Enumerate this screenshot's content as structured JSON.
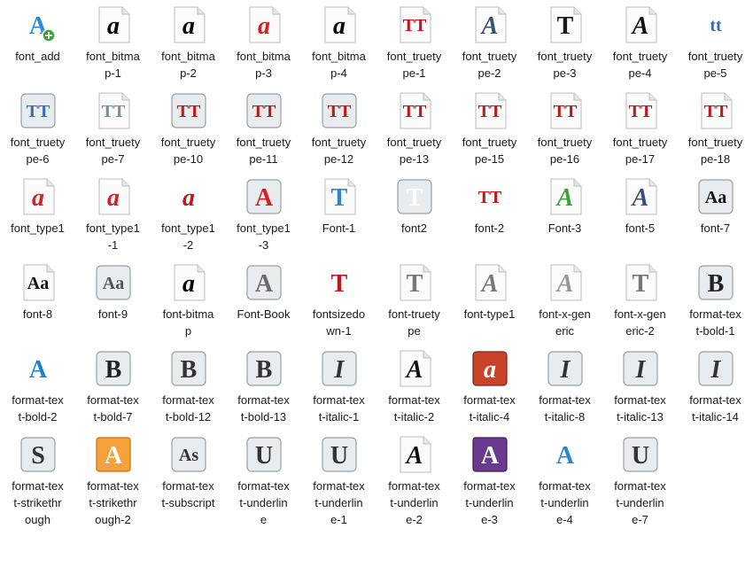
{
  "icons": [
    {
      "label": "font_add",
      "glyph": "A",
      "style": "plain",
      "color": "#2a8bd6",
      "badge": "plus"
    },
    {
      "label": "font_bitma\np-1",
      "glyph": "a",
      "style": "page",
      "color": "#000000"
    },
    {
      "label": "font_bitma\np-2",
      "glyph": "a",
      "style": "page",
      "color": "#000000"
    },
    {
      "label": "font_bitma\np-3",
      "glyph": "a",
      "style": "page",
      "color": "#d62020"
    },
    {
      "label": "font_bitma\np-4",
      "glyph": "a",
      "style": "page",
      "color": "#000000"
    },
    {
      "label": "font_truety\npe-1",
      "glyph": "TT",
      "style": "page",
      "color": "#c01818"
    },
    {
      "label": "font_truety\npe-2",
      "glyph": "A",
      "style": "page",
      "color": "#3a4f78"
    },
    {
      "label": "font_truety\npe-3",
      "glyph": "T",
      "style": "page",
      "color": "#1a1a1a"
    },
    {
      "label": "font_truety\npe-4",
      "glyph": "A",
      "style": "page",
      "color": "#111111"
    },
    {
      "label": "font_truety\npe-5",
      "glyph": "tt",
      "style": "plain",
      "color": "#2f6ab8"
    },
    {
      "label": "font_truety\npe-6",
      "glyph": "TT",
      "style": "box",
      "color": "#3a6fb0"
    },
    {
      "label": "font_truety\npe-7",
      "glyph": "TT",
      "style": "page",
      "color": "#7f8c9a"
    },
    {
      "label": "font_truety\npe-10",
      "glyph": "TT",
      "style": "box",
      "color": "#c01818"
    },
    {
      "label": "font_truety\npe-11",
      "glyph": "TT",
      "style": "box",
      "color": "#c01818"
    },
    {
      "label": "font_truety\npe-12",
      "glyph": "TT",
      "style": "box",
      "color": "#c01818"
    },
    {
      "label": "font_truety\npe-13",
      "glyph": "TT",
      "style": "page",
      "color": "#c01818"
    },
    {
      "label": "font_truety\npe-15",
      "glyph": "TT",
      "style": "page",
      "color": "#c01818"
    },
    {
      "label": "font_truety\npe-16",
      "glyph": "TT",
      "style": "page",
      "color": "#c01818"
    },
    {
      "label": "font_truety\npe-17",
      "glyph": "TT",
      "style": "page",
      "color": "#c01818"
    },
    {
      "label": "font_truety\npe-18",
      "glyph": "TT",
      "style": "page",
      "color": "#c01818"
    },
    {
      "label": "font_type1",
      "glyph": "a",
      "style": "page",
      "color": "#d62020"
    },
    {
      "label": "font_type1\n-1",
      "glyph": "a",
      "style": "page",
      "color": "#d62020"
    },
    {
      "label": "font_type1\n-2",
      "glyph": "a",
      "style": "plain",
      "color": "#b81c1c"
    },
    {
      "label": "font_type1\n-3",
      "glyph": "A",
      "style": "box",
      "color": "#d62020"
    },
    {
      "label": "Font-1",
      "glyph": "T",
      "style": "page",
      "color": "#2f86c9"
    },
    {
      "label": "font2",
      "glyph": "T",
      "style": "box",
      "color": "#ffffff"
    },
    {
      "label": "font-2",
      "glyph": "TT",
      "style": "plain",
      "color": "#c01818"
    },
    {
      "label": "Font-3",
      "glyph": "A",
      "style": "page",
      "color": "#3aa236"
    },
    {
      "label": "font-5",
      "glyph": "A",
      "style": "page",
      "color": "#3a4f78"
    },
    {
      "label": "font-7",
      "glyph": "Aa",
      "style": "box",
      "color": "#111111"
    },
    {
      "label": "font-8",
      "glyph": "Aa",
      "style": "page",
      "color": "#111111"
    },
    {
      "label": "font-9",
      "glyph": "Aa",
      "style": "box",
      "color": "#4a5560"
    },
    {
      "label": "font-bitma\np",
      "glyph": "a",
      "style": "page",
      "color": "#000000"
    },
    {
      "label": "Font-Book",
      "glyph": "A",
      "style": "box",
      "color": "#6b6b6b"
    },
    {
      "label": "fontsizedo\nwn-1",
      "glyph": "T",
      "style": "plain",
      "color": "#c01818"
    },
    {
      "label": "font-truety\npe",
      "glyph": "T",
      "style": "page",
      "color": "#777777"
    },
    {
      "label": "font-type1",
      "glyph": "A",
      "style": "page",
      "color": "#777777"
    },
    {
      "label": "font-x-gen\neric",
      "glyph": "A",
      "style": "page",
      "color": "#999999"
    },
    {
      "label": "font-x-gen\neric-2",
      "glyph": "T",
      "style": "page",
      "color": "#777777"
    },
    {
      "label": "format-tex\nt-bold-1",
      "glyph": "B",
      "style": "box",
      "color": "#222222"
    },
    {
      "label": "format-tex\nt-bold-2",
      "glyph": "A",
      "style": "plain",
      "color": "#1f7fd4"
    },
    {
      "label": "format-tex\nt-bold-7",
      "glyph": "B",
      "style": "box",
      "color": "#222222"
    },
    {
      "label": "format-tex\nt-bold-12",
      "glyph": "B",
      "style": "box",
      "color": "#333333"
    },
    {
      "label": "format-tex\nt-bold-13",
      "glyph": "B",
      "style": "box",
      "color": "#333333"
    },
    {
      "label": "format-tex\nt-italic-1",
      "glyph": "I",
      "style": "box",
      "color": "#333333"
    },
    {
      "label": "format-tex\nt-italic-2",
      "glyph": "A",
      "style": "page",
      "color": "#111111"
    },
    {
      "label": "format-tex\nt-italic-4",
      "glyph": "a",
      "style": "dark",
      "color": "#ffffff"
    },
    {
      "label": "format-tex\nt-italic-8",
      "glyph": "I",
      "style": "box",
      "color": "#333333"
    },
    {
      "label": "format-tex\nt-italic-13",
      "glyph": "I",
      "style": "box",
      "color": "#333333"
    },
    {
      "label": "format-tex\nt-italic-14",
      "glyph": "I",
      "style": "box",
      "color": "#333333"
    },
    {
      "label": "format-tex\nt-strikethr\nough",
      "glyph": "S",
      "style": "box",
      "color": "#333333"
    },
    {
      "label": "format-tex\nt-strikethr\nough-2",
      "glyph": "A",
      "style": "orange",
      "color": "#ffffff"
    },
    {
      "label": "format-tex\nt-subscript",
      "glyph": "As",
      "style": "box",
      "color": "#333333"
    },
    {
      "label": "format-tex\nt-underlin\ne",
      "glyph": "U",
      "style": "box",
      "color": "#333333"
    },
    {
      "label": "format-tex\nt-underlin\ne-1",
      "glyph": "U",
      "style": "box",
      "color": "#333333"
    },
    {
      "label": "format-tex\nt-underlin\ne-2",
      "glyph": "A",
      "style": "page",
      "color": "#111111"
    },
    {
      "label": "format-tex\nt-underlin\ne-3",
      "glyph": "A",
      "style": "purple",
      "color": "#ffffff"
    },
    {
      "label": "format-tex\nt-underlin\ne-4",
      "glyph": "A",
      "style": "plain",
      "color": "#2f86c9"
    },
    {
      "label": "format-tex\nt-underlin\ne-7",
      "glyph": "U",
      "style": "box",
      "color": "#333333"
    }
  ]
}
